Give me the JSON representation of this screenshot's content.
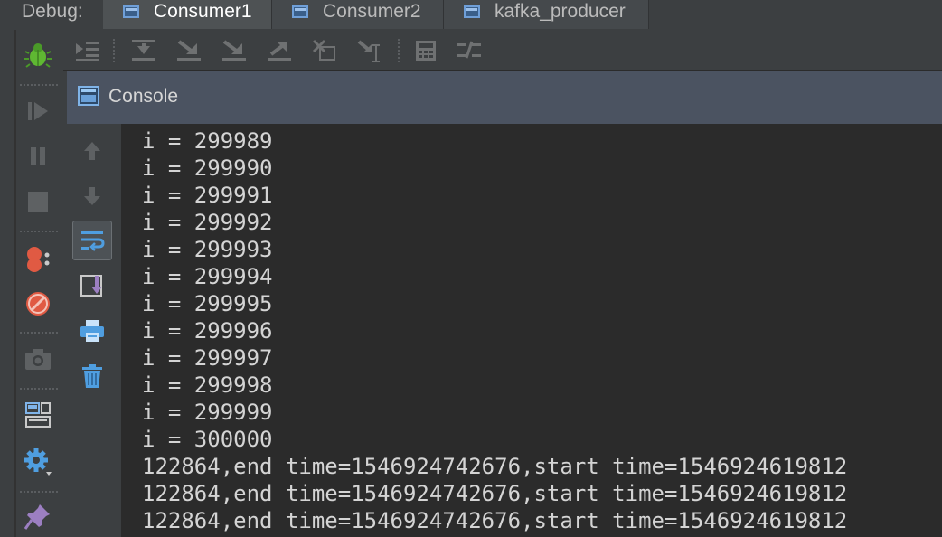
{
  "debug_bar": {
    "label": "Debug:",
    "tabs": [
      {
        "label": "Consumer1",
        "active": true
      },
      {
        "label": "Consumer2",
        "active": false
      },
      {
        "label": "kafka_producer",
        "active": false
      }
    ]
  },
  "console": {
    "title": "Console",
    "lines": [
      "i = 299989",
      "i = 299990",
      "i = 299991",
      "i = 299992",
      "i = 299993",
      "i = 299994",
      "i = 299995",
      "i = 299996",
      "i = 299997",
      "i = 299998",
      "i = 299999",
      "i = 300000",
      "122864,end time=1546924742676,start time=1546924619812",
      "122864,end time=1546924742676,start time=1546924619812",
      "122864,end time=1546924742676,start time=1546924619812"
    ]
  },
  "left_toolbar": {
    "icons": [
      "debug-bug-icon",
      "resume-icon",
      "pause-icon",
      "stop-icon",
      "view-breakpoints-icon",
      "mute-breakpoints-icon",
      "camera-icon",
      "layout-icon",
      "settings-icon",
      "pin-icon"
    ]
  },
  "debug_toolbar": {
    "icons": [
      "show-execution-point-icon",
      "step-over-icon",
      "step-into-icon",
      "force-step-into-icon",
      "step-out-icon",
      "drop-frame-icon",
      "run-to-cursor-icon",
      "evaluate-expression-icon",
      "trace-icon"
    ]
  },
  "console_side": {
    "icons": [
      "up-arrow-icon",
      "down-arrow-icon",
      "soft-wrap-icon",
      "scroll-to-end-icon",
      "print-icon",
      "trash-icon"
    ]
  },
  "colors": {
    "background": "#3c3f41",
    "console_bg": "#2b2b2b",
    "console_header": "#4b5361",
    "text": "#d4d4d4",
    "accent_blue": "#4f9ee0"
  }
}
